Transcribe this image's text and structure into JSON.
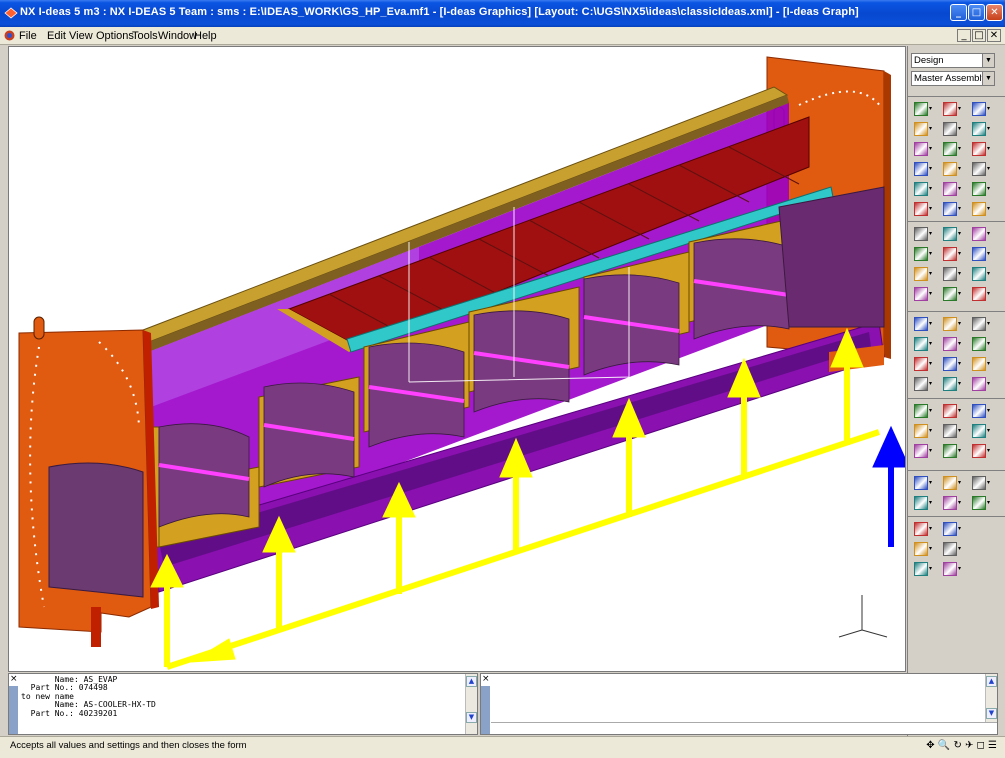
{
  "titlebar": {
    "title": "NX I-deas 5 m3 :    NX I-DEAS 5 Team : sms : E:\\IDEAS_WORK\\GS_HP_Eva.mf1  - [I-deas Graphics]   [Layout: C:\\UGS\\NX5\\ideas\\classicIdeas.xml]    - [I-deas Graph]",
    "minimize": "_",
    "maximize": "□",
    "close": "✕"
  },
  "menubar": {
    "items": [
      "File",
      "Edit",
      "View",
      "Options",
      "Tools",
      "Window",
      "Help"
    ],
    "mdi_minimize": "_",
    "mdi_restore": "□",
    "mdi_close": "✕"
  },
  "rightpanel": {
    "task_dropdown": "Design",
    "assembly_dropdown": "Master Assembly"
  },
  "output": {
    "text": "       Name: AS_EVAP\n  Part No.: 074498\nto new name\n       Name: AS-COOLER-HX-TD\n  Part No.: 40239201"
  },
  "statusbar": {
    "message": "Accepts all values and settings and then closes the form",
    "icons": "✥ 🔍 ↻ ✈ ◻ ☰"
  },
  "colors": {
    "tube_sheet": "#e05a10",
    "baffle": "#d4a020",
    "partition": "#9a00c8",
    "red_tube": "#c01010",
    "cyan_bar": "#30c8c8",
    "arrow_yellow": "#ffff00",
    "arrow_blue": "#0000ff"
  }
}
